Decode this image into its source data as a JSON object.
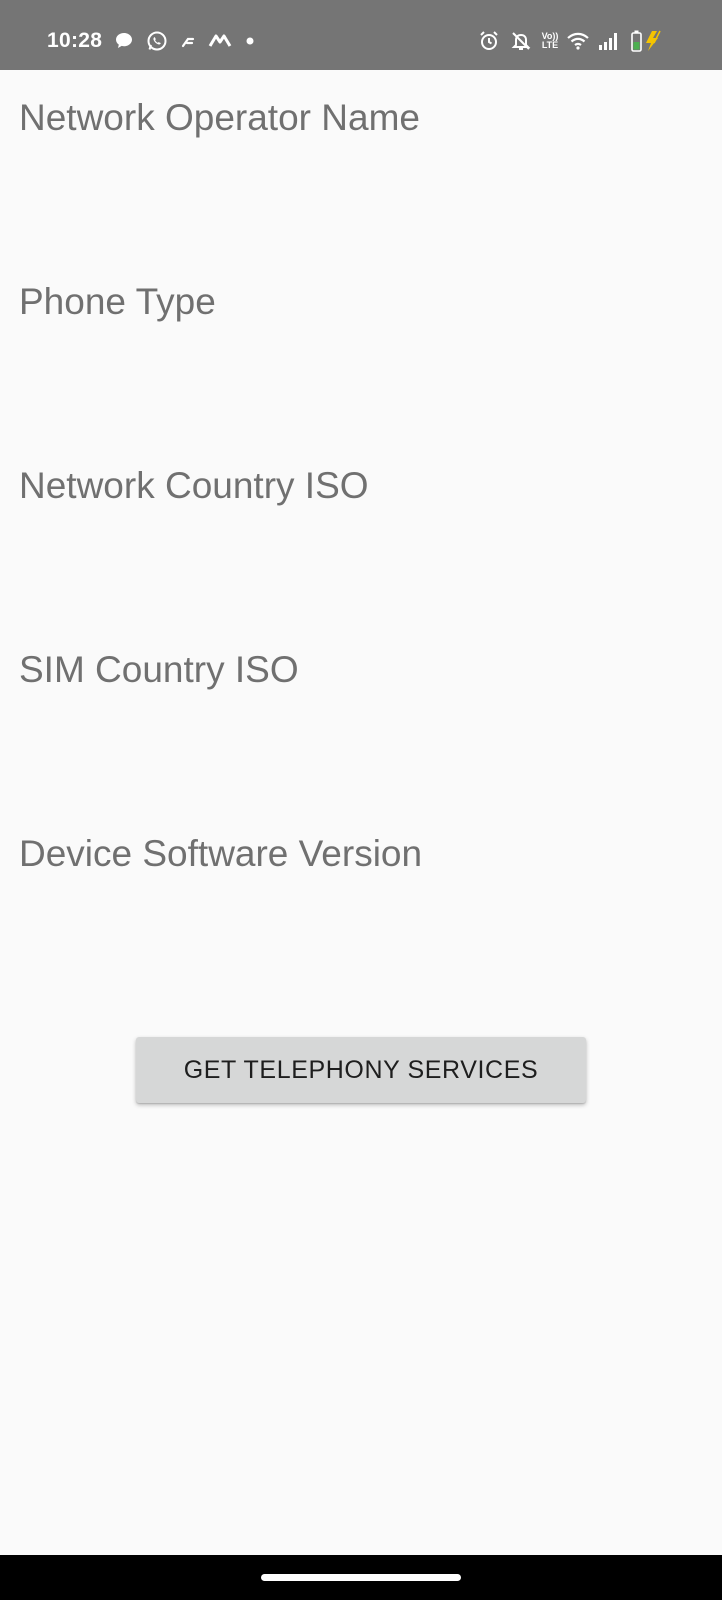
{
  "status_bar": {
    "time": "10:28",
    "volte_top": "Vo))",
    "volte_bottom": "LTE",
    "icons": [
      "chat-bubble-icon",
      "whatsapp-icon",
      "notification-icon",
      "app-icon",
      "dot-icon",
      "alarm-icon",
      "bell-off-icon",
      "volte-icon",
      "wifi-icon",
      "signal-icon",
      "battery-charging-icon"
    ],
    "colors": {
      "background": "#757575",
      "battery_level": "#4caf50",
      "charging_bolt": "#f5c400"
    }
  },
  "info": {
    "network_operator_name": "Network Operator Name",
    "phone_type": "Phone Type",
    "network_country_iso": "Network Country ISO",
    "sim_country_iso": "SIM Country ISO",
    "device_software_version": "Device Software Version"
  },
  "button": {
    "label": "GET TELEPHONY SERVICES"
  },
  "nav_bar": {
    "icons": [
      "home-handle-icon"
    ]
  }
}
